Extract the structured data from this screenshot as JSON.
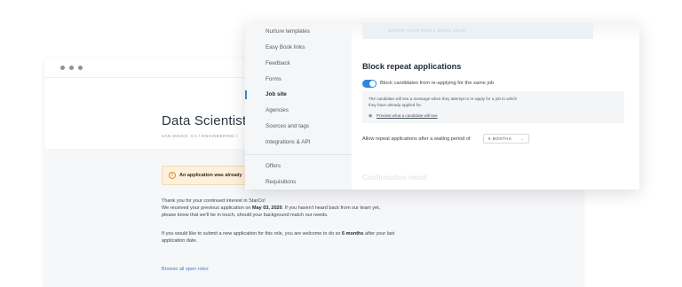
{
  "background_page": {
    "job_title": "Data Scientist",
    "job_meta": "SAN DIEGO, CA  /  ENGINEERING  /",
    "alert_text": "An application was already",
    "paragraph1_line1": "Thank you for your continued interest in StarCo!",
    "paragraph1_line2_pre": "We received your previous application on ",
    "paragraph1_line2_date": "May 03, 2020",
    "paragraph1_line2_post": ". If you haven't heard back from our team yet,",
    "paragraph1_line3": "please know that we'll be in touch, should your background match our needs.",
    "paragraph2_line1_pre": "If you would like to submit a new application for this role, you are welcome to do so ",
    "paragraph2_line1_bold": "6 months",
    "paragraph2_line1_post": " after your last",
    "paragraph2_line2": "application date.",
    "browse_link": "Browse all open roles"
  },
  "sidebar": {
    "items": [
      {
        "label": "Nurture templates"
      },
      {
        "label": "Easy Book links"
      },
      {
        "label": "Feedback"
      },
      {
        "label": "Forms"
      },
      {
        "label": "Job site"
      },
      {
        "label": "Agencies"
      },
      {
        "label": "Sources and tags"
      },
      {
        "label": "Integrations & API"
      },
      {
        "label": "Offers"
      },
      {
        "label": "Requisitions"
      }
    ],
    "active_item": "Job site"
  },
  "settings": {
    "faded_header_text": "ENTER YOUR REPLY EMAIL HERE",
    "section_title": "Block repeat applications",
    "toggle_label": "Block candidates from re-applying for the same job",
    "toggle_on": true,
    "info_line1": "The candidate will see a message when they attempt to re-apply for a job to which",
    "info_line2": "they have already applied for.",
    "preview_link": "Preview what a candidate will see",
    "allow_label": "Allow repeat applications after a waiting period of",
    "period_value": "6 MONTHS",
    "next_section_title": "Confirmation email"
  },
  "colors": {
    "accent": "#2f86e0",
    "alert_bg": "#fdf0dc",
    "link": "#3f7fc9"
  }
}
